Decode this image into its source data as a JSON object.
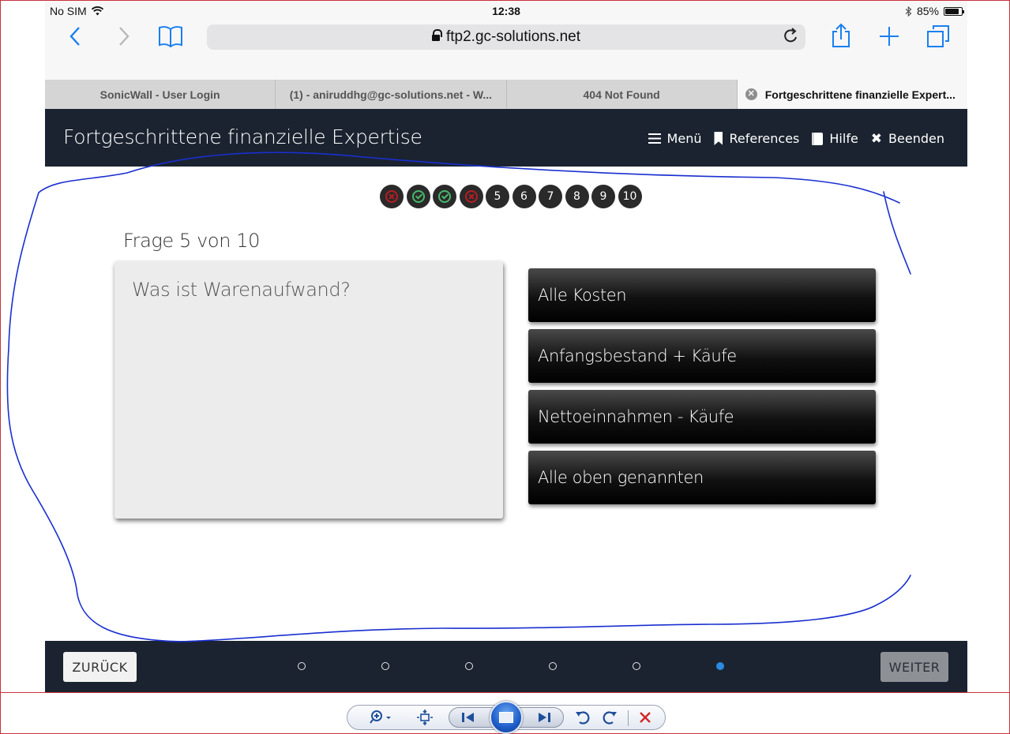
{
  "status_bar": {
    "carrier": "No SIM",
    "time": "12:38",
    "battery": "85%",
    "battery_level": 0.85
  },
  "browser": {
    "url": "ftp2.gc-solutions.net",
    "tabs": [
      {
        "label": "SonicWall - User Login",
        "active": false
      },
      {
        "label": "(1) - aniruddhg@gc-solutions.net - W...",
        "active": false
      },
      {
        "label": "404 Not Found",
        "active": false
      },
      {
        "label": "Fortgeschrittene finanzielle Expert...",
        "active": true
      }
    ]
  },
  "course": {
    "title": "Fortgeschrittene finanzielle Expertise",
    "nav": {
      "menu": "Menü",
      "references": "References",
      "help": "Hilfe",
      "exit": "Beenden"
    }
  },
  "question_progress": [
    {
      "state": "wrong",
      "label": ""
    },
    {
      "state": "correct",
      "label": ""
    },
    {
      "state": "correct",
      "label": ""
    },
    {
      "state": "wrong",
      "label": ""
    },
    {
      "state": "pending",
      "label": "5"
    },
    {
      "state": "pending",
      "label": "6"
    },
    {
      "state": "pending",
      "label": "7"
    },
    {
      "state": "pending",
      "label": "8"
    },
    {
      "state": "pending",
      "label": "9"
    },
    {
      "state": "pending",
      "label": "10"
    }
  ],
  "quiz": {
    "counter": "Frage 5 von 10",
    "question": "Was ist Warenaufwand?",
    "answers": [
      "Alle Kosten",
      "Anfangsbestand + Käufe",
      "Nettoeinnahmen - Käufe",
      "Alle oben genannten"
    ]
  },
  "footer": {
    "back_label": "ZURÜCK",
    "next_label": "WEITER",
    "slide_count": 6,
    "active_slide": 6
  },
  "colors": {
    "header_bg": "#1b2330",
    "annotation_ink": "#1a2fd0",
    "accent_blue": "#2a8ae0",
    "wrong_red": "#b81d22",
    "correct_green": "#48b86b"
  }
}
